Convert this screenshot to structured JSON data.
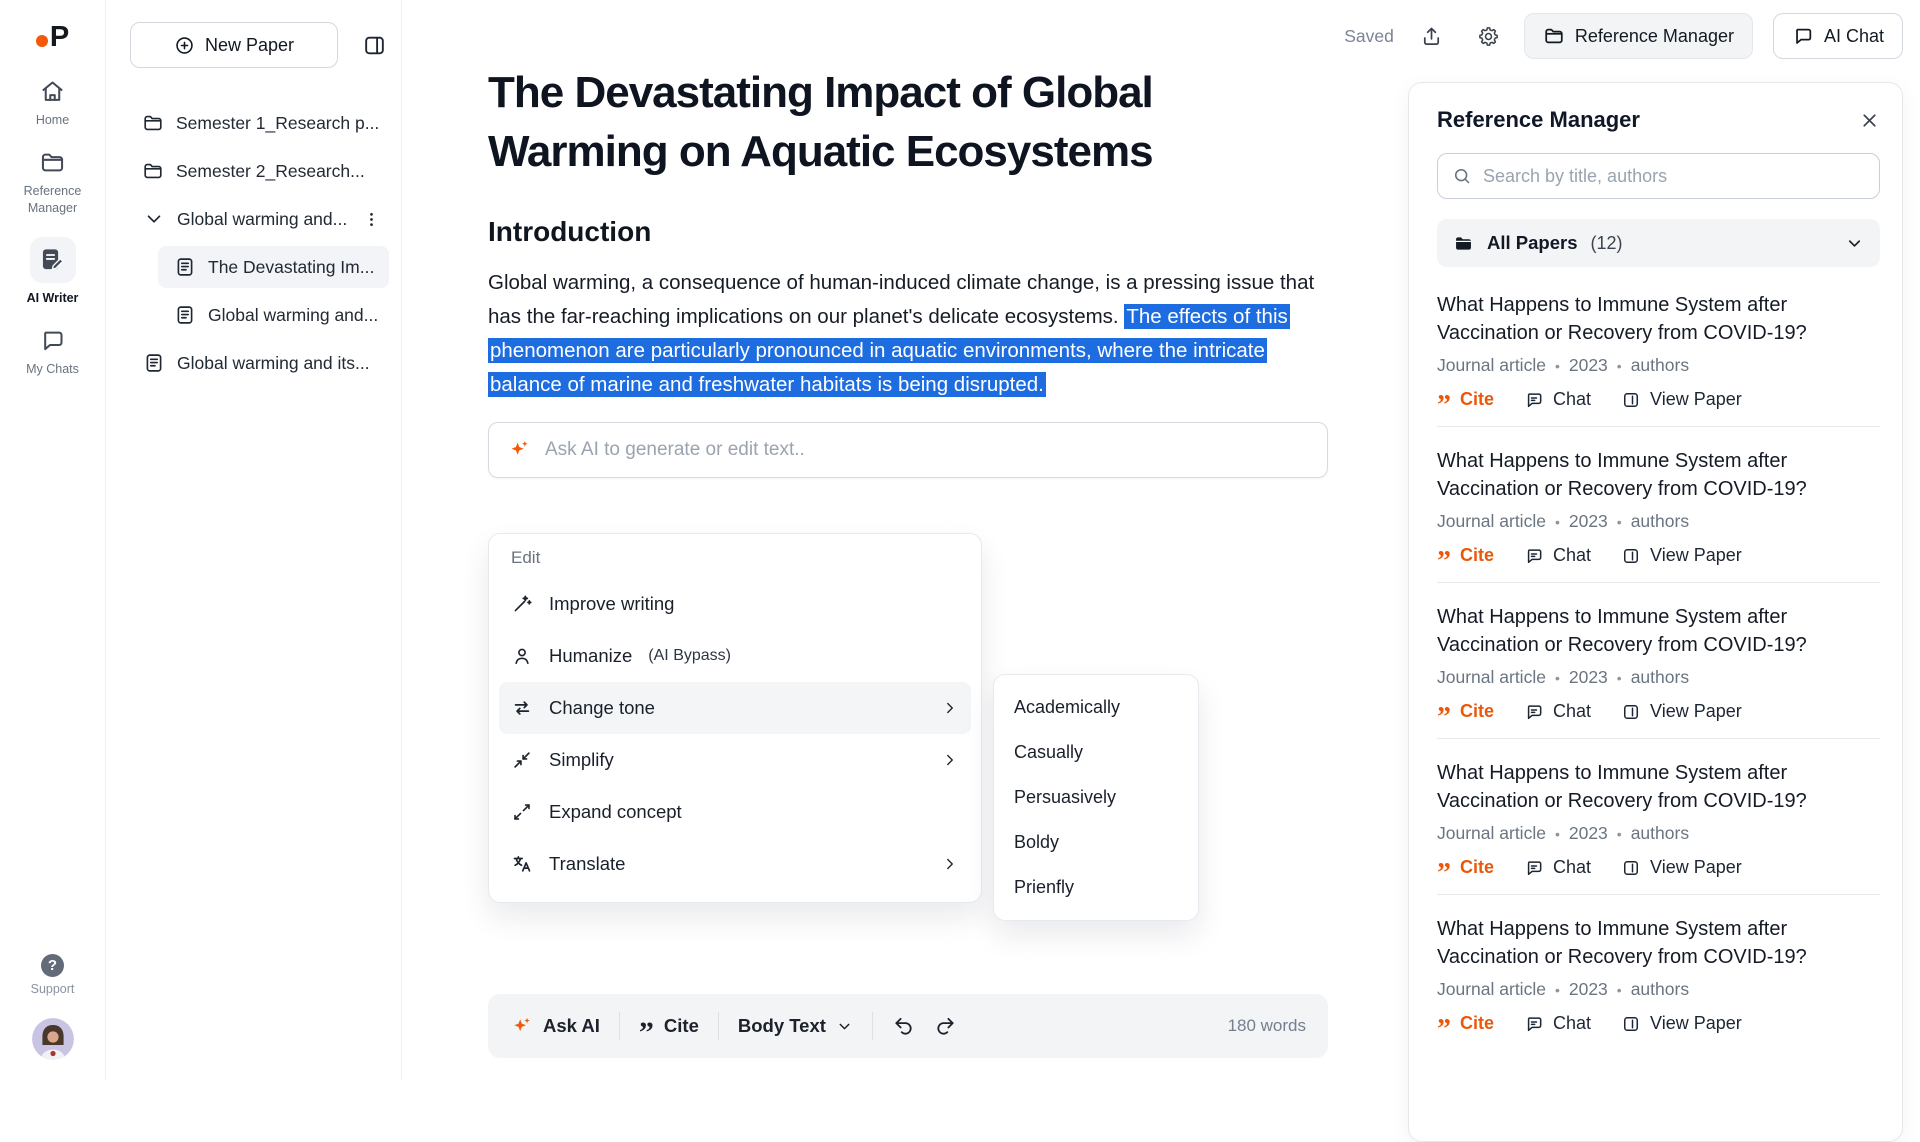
{
  "colors": {
    "accent_orange": "#f4590b",
    "highlight_blue": "#1e6de0",
    "cite_orange": "#e8590c"
  },
  "topbar": {
    "saved": "Saved",
    "share_icon": "share-icon",
    "settings_icon": "gear-icon",
    "reference_manager_button": "Reference Manager",
    "ai_chat_button": "AI Chat"
  },
  "iconbar": {
    "logo_letter": "P",
    "items": [
      {
        "icon": "home-icon",
        "label": "Home",
        "active": false
      },
      {
        "icon": "folder-icon",
        "label": "Reference Manager",
        "active": false
      },
      {
        "icon": "writer-icon",
        "label": "AI Writer",
        "active": true
      },
      {
        "icon": "chat-icon",
        "label": "My Chats",
        "active": false
      }
    ],
    "support_label": "Support"
  },
  "treepanel": {
    "new_paper_button": "New Paper",
    "items": [
      {
        "kind": "folder",
        "label": "Semester 1_Research p...",
        "indent": 0,
        "selected": false,
        "menu": false
      },
      {
        "kind": "folder",
        "label": "Semester 2_Research...",
        "indent": 0,
        "selected": false,
        "menu": false
      },
      {
        "kind": "folder-open",
        "label": "Global warming and...",
        "indent": 0,
        "selected": false,
        "menu": true
      },
      {
        "kind": "doc",
        "label": "The Devastating Im...",
        "indent": 1,
        "selected": true,
        "menu": false
      },
      {
        "kind": "doc",
        "label": "Global warming and...",
        "indent": 1,
        "selected": false,
        "menu": false
      },
      {
        "kind": "doc",
        "label": "Global warming and its...",
        "indent": 0,
        "selected": false,
        "menu": false
      }
    ]
  },
  "editor": {
    "title": "The Devastating Impact of Global Warming on Aquatic Ecosystems",
    "heading": "Introduction",
    "paragraph": {
      "normal": "Global warming, a consequence of human-induced climate change, is a pressing issue that has the far-reaching implications on our planet's delicate ecosystems. ",
      "highlighted": "The effects of this phenomenon are particularly pronounced in aquatic environments, where the intricate balance of marine and freshwater habitats is being disrupted."
    },
    "ask_ai_placeholder": "Ask AI to generate or edit text..",
    "menu": {
      "section_label": "Edit",
      "items": [
        {
          "icon": "wand-icon",
          "label": "Improve writing",
          "note": "",
          "submenu": false,
          "highlighted": false
        },
        {
          "icon": "person-icon",
          "label": "Humanize",
          "note": "(AI Bypass)",
          "submenu": false,
          "highlighted": false
        },
        {
          "icon": "swap-icon",
          "label": "Change tone",
          "note": "",
          "submenu": true,
          "highlighted": true
        },
        {
          "icon": "shrink-icon",
          "label": "Simplify",
          "note": "",
          "submenu": true,
          "highlighted": false
        },
        {
          "icon": "expand-icon",
          "label": "Expand concept",
          "note": "",
          "submenu": false,
          "highlighted": false
        },
        {
          "icon": "translate-icon",
          "label": "Translate",
          "note": "",
          "submenu": true,
          "highlighted": false
        }
      ]
    },
    "tone_submenu": [
      "Academically",
      "Casually",
      "Persuasively",
      "Boldy",
      "Prienfly"
    ],
    "toolbar": {
      "ask_ai": "Ask AI",
      "cite": "Cite",
      "body_text": "Body Text",
      "word_count": "180 words"
    }
  },
  "refpanel": {
    "title": "Reference Manager",
    "search_placeholder": "Search by title, authors",
    "collection": {
      "label": "All Papers",
      "count": "(12)"
    },
    "actions": {
      "cite": "Cite",
      "chat": "Chat",
      "view": "View Paper"
    },
    "meta_separator": "•",
    "papers": [
      {
        "title": "What Happens to Immune System after Vaccination or Recovery from COVID-19?",
        "type": "Journal article",
        "year": "2023",
        "authors": "authors"
      },
      {
        "title": "What Happens to Immune System after Vaccination or Recovery from COVID-19?",
        "type": "Journal article",
        "year": "2023",
        "authors": "authors"
      },
      {
        "title": "What Happens to Immune System after Vaccination or Recovery from COVID-19?",
        "type": "Journal article",
        "year": "2023",
        "authors": "authors"
      },
      {
        "title": "What Happens to Immune System after Vaccination or Recovery from COVID-19?",
        "type": "Journal article",
        "year": "2023",
        "authors": "authors"
      },
      {
        "title": "What Happens to Immune System after Vaccination or Recovery from COVID-19?",
        "type": "Journal article",
        "year": "2023",
        "authors": "authors"
      }
    ]
  }
}
